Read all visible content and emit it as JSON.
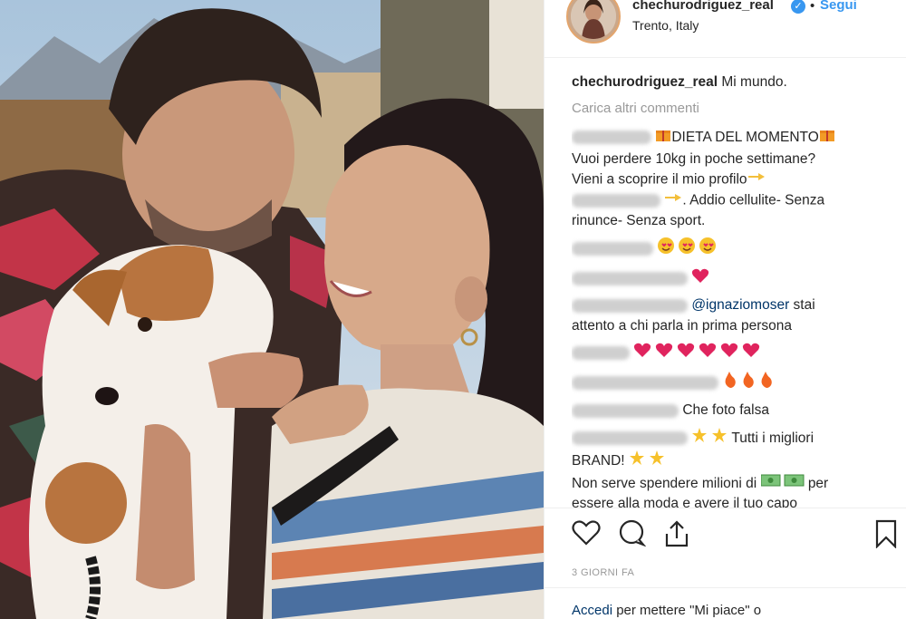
{
  "post": {
    "username": "chechurodriguez_real",
    "verified_icon": "verified-badge-icon",
    "follow_label": "Segui",
    "dot": "•",
    "location": "Trento, Italy",
    "caption_user": "chechurodriguez_real",
    "caption_text": "Mi mundo.",
    "load_more": "Carica altri commenti",
    "time_ago": "3 GIORNI FA",
    "login_link": "Accedi",
    "login_text": "per mettere \"Mi piace\" o"
  },
  "comments": [
    {
      "text1": "DIETA DEL MOMENTO",
      "text2": "Vuoi perdere 10kg in poche settimane?",
      "text3": "Vieni a scoprire il mio profilo",
      "text4": ". Addio cellulite- Senza",
      "text5": "rinunce- Senza sport."
    },
    {
      "text": ""
    },
    {
      "text": ""
    },
    {
      "mention": "@ignaziomoser",
      "text": "stai",
      "text2": "attento a chi parla in prima persona"
    },
    {
      "text": ""
    },
    {
      "text": ""
    },
    {
      "text": "Che foto falsa"
    },
    {
      "text1": "Tutti i migliori",
      "text2": "BRAND!",
      "text3": "Non serve spendere milioni di",
      "text4": "per",
      "text5": "essere alla moda e avere il tuo capo"
    }
  ],
  "colors": {
    "link": "#3897f0",
    "mention": "#003569",
    "muted": "#999999",
    "heart": "#ed4956"
  },
  "icons": [
    "heart-icon",
    "comment-icon",
    "share-icon",
    "bookmark-icon"
  ]
}
